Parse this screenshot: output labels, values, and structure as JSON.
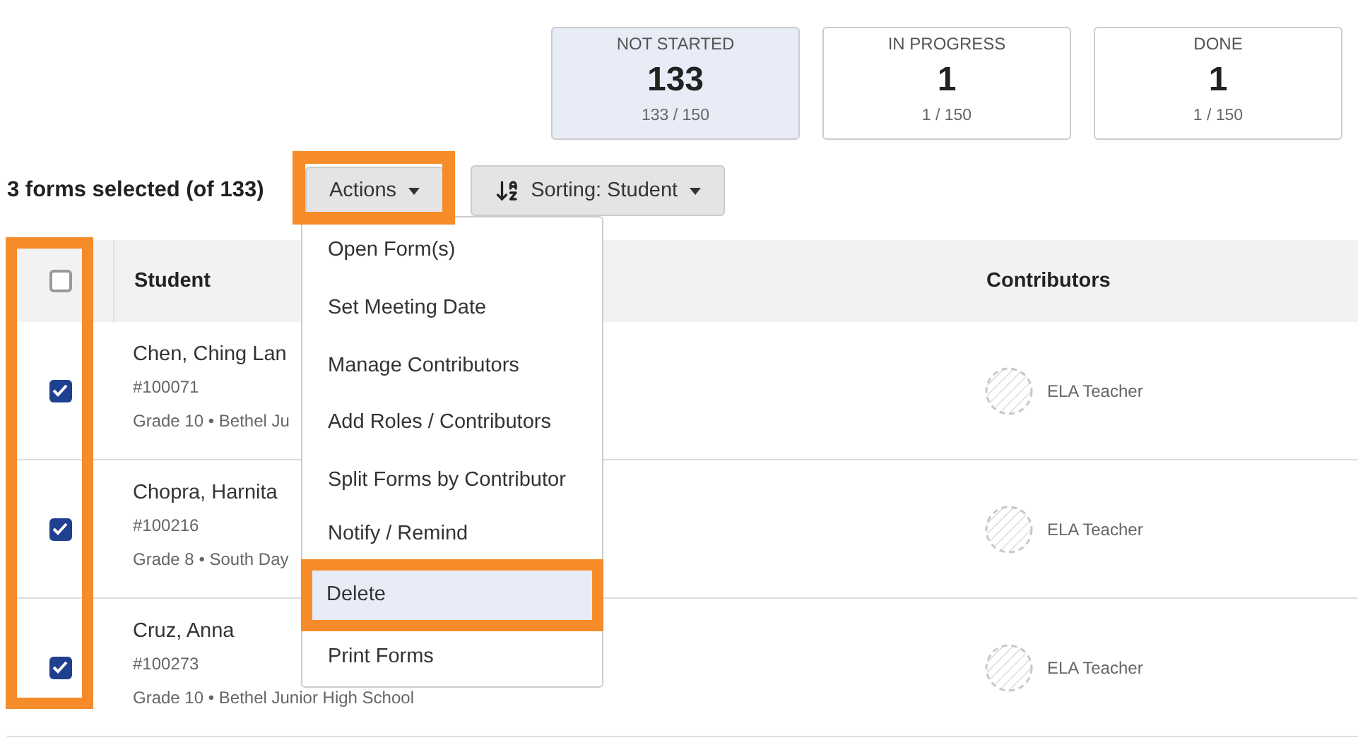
{
  "stats": [
    {
      "label": "NOT STARTED",
      "count": "133",
      "fraction": "133 / 150",
      "selected": true
    },
    {
      "label": "IN PROGRESS",
      "count": "1",
      "fraction": "1 / 150",
      "selected": false
    },
    {
      "label": "DONE",
      "count": "1",
      "fraction": "1 / 150",
      "selected": false
    }
  ],
  "selection_summary": "3 forms selected (of 133)",
  "actions_button": {
    "label": "Actions",
    "highlighted": true
  },
  "sort_button": {
    "label": "Sorting: Student"
  },
  "actions_menu": {
    "items": [
      {
        "label": "Open Form(s)",
        "selected": false,
        "highlighted": false
      },
      {
        "label": "Set Meeting Date",
        "selected": false,
        "highlighted": false
      },
      {
        "label": "Manage Contributors",
        "selected": false,
        "highlighted": false
      },
      {
        "label": "Add Roles / Contributors",
        "selected": false,
        "highlighted": false
      },
      {
        "label": "Split Forms by Contributor",
        "selected": false,
        "highlighted": false
      },
      {
        "label": "Notify / Remind",
        "selected": false,
        "highlighted": false
      },
      {
        "label": "Delete",
        "selected": true,
        "highlighted": true
      },
      {
        "label": "Print Forms",
        "selected": false,
        "highlighted": false
      }
    ]
  },
  "table": {
    "select_all": {
      "checked": false
    },
    "checkbox_column_highlighted": true,
    "columns": [
      "Student",
      "Contributors"
    ],
    "rows": [
      {
        "checked": true,
        "name": "Chen, Ching Lan",
        "id": "#100071",
        "details": "Grade 10 • Bethel Ju",
        "contributor": "ELA Teacher"
      },
      {
        "checked": true,
        "name": "Chopra, Harnita",
        "id": "#100216",
        "details": "Grade 8 • South Day",
        "contributor": "ELA Teacher"
      },
      {
        "checked": true,
        "name": "Cruz, Anna",
        "id": "#100273",
        "details": "Grade 10 • Bethel Junior High School",
        "contributor": "ELA Teacher"
      }
    ]
  }
}
